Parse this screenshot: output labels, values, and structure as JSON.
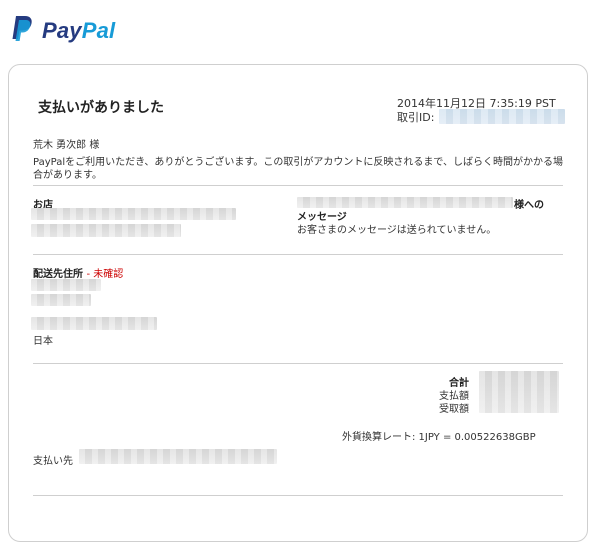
{
  "brand": {
    "name_part1": "Pay",
    "name_part2": "Pal",
    "color_dark": "#253b80",
    "color_light": "#179bd7",
    "icon": "paypal-logo-icon"
  },
  "receipt": {
    "title": "支払いがありました",
    "datetime": "2014年11月12日 7:35:19 PST",
    "transaction_id_label": "取引ID:",
    "customer_name": "荒木 勇次郎 様",
    "notice": "PayPalをご利用いただき、ありがとうございます。この取引がアカウントに反映されるまで、しばらく時間がかかる場合があります。",
    "store_label": "お店",
    "message_to_suffix": "様への",
    "message_label": "メッセージ",
    "message_text": "お客さまのメッセージは送られていません。",
    "shipping_label": "配送先住所",
    "shipping_status": "- 未確認",
    "country": "日本",
    "total_label": "合計",
    "paid_label": "支払額",
    "received_label": "受取額",
    "exchange_rate": "外貨換算レート: 1JPY = 0.00522638GBP",
    "pay_to_label": "支払い先"
  },
  "colors": {
    "warning_red": "#cc0000",
    "divider": "#cfcfcf"
  }
}
